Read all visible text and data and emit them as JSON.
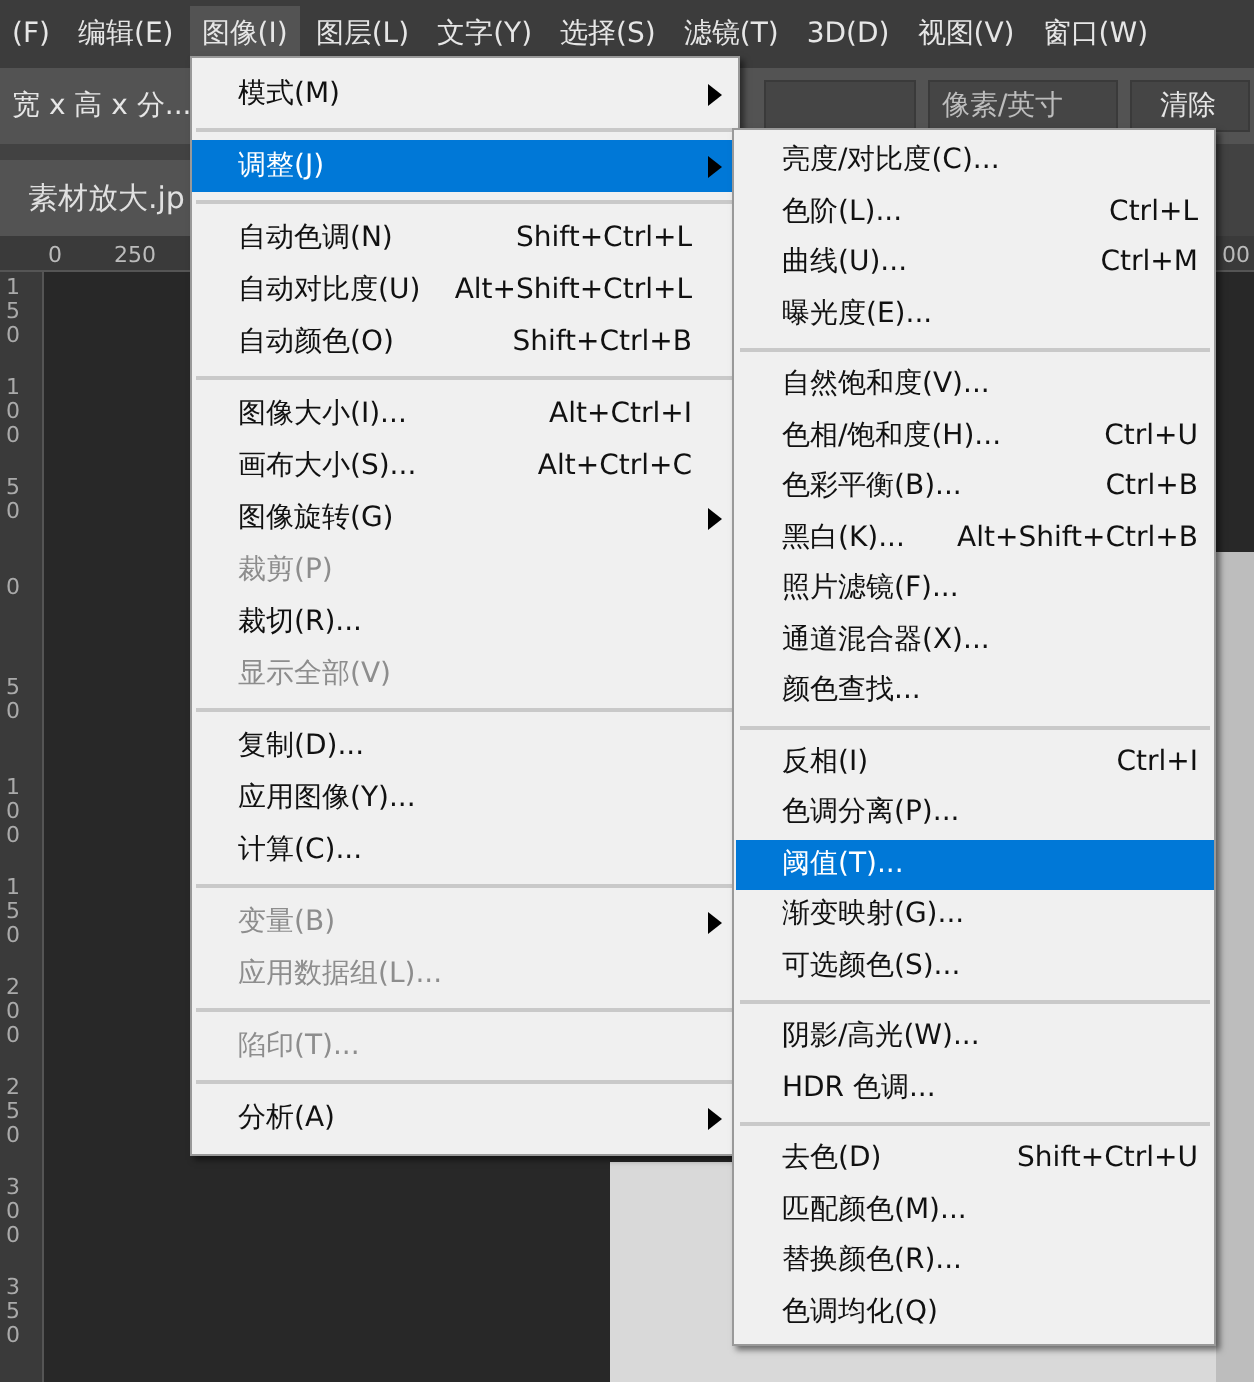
{
  "menubar": [
    {
      "label": "(F)",
      "selected": false
    },
    {
      "label": "编辑(E)",
      "selected": false
    },
    {
      "label": "图像(I)",
      "selected": true
    },
    {
      "label": "图层(L)",
      "selected": false
    },
    {
      "label": "文字(Y)",
      "selected": false
    },
    {
      "label": "选择(S)",
      "selected": false
    },
    {
      "label": "滤镜(T)",
      "selected": false
    },
    {
      "label": "3D(D)",
      "selected": false
    },
    {
      "label": "视图(V)",
      "selected": false
    },
    {
      "label": "窗口(W)",
      "selected": false
    }
  ],
  "options_bar": {
    "size_dropdown": "宽 x 高 x 分...",
    "unit_dropdown": "像素/英寸",
    "clear_button": "清除"
  },
  "document_tab": {
    "title": "素材放大.jp"
  },
  "horizontal_ruler": [
    "0",
    "250",
    "00"
  ],
  "vertical_ruler": [
    "150",
    "100",
    "50",
    "0",
    "50",
    "100",
    "150",
    "200",
    "250",
    "300",
    "350"
  ],
  "image_menu": [
    {
      "kind": "item",
      "label": "模式(M)",
      "submenu": true,
      "disabled": false,
      "selected": false
    },
    {
      "kind": "separator"
    },
    {
      "kind": "item",
      "label": "调整(J)",
      "submenu": true,
      "disabled": false,
      "selected": true
    },
    {
      "kind": "separator"
    },
    {
      "kind": "item",
      "label": "自动色调(N)",
      "shortcut": "Shift+Ctrl+L",
      "submenu": false,
      "disabled": false,
      "selected": false
    },
    {
      "kind": "item",
      "label": "自动对比度(U)",
      "shortcut": "Alt+Shift+Ctrl+L",
      "submenu": false,
      "disabled": false,
      "selected": false
    },
    {
      "kind": "item",
      "label": "自动颜色(O)",
      "shortcut": "Shift+Ctrl+B",
      "submenu": false,
      "disabled": false,
      "selected": false
    },
    {
      "kind": "separator"
    },
    {
      "kind": "item",
      "label": "图像大小(I)...",
      "shortcut": "Alt+Ctrl+I",
      "submenu": false,
      "disabled": false,
      "selected": false
    },
    {
      "kind": "item",
      "label": "画布大小(S)...",
      "shortcut": "Alt+Ctrl+C",
      "submenu": false,
      "disabled": false,
      "selected": false
    },
    {
      "kind": "item",
      "label": "图像旋转(G)",
      "submenu": true,
      "disabled": false,
      "selected": false
    },
    {
      "kind": "item",
      "label": "裁剪(P)",
      "submenu": false,
      "disabled": true,
      "selected": false
    },
    {
      "kind": "item",
      "label": "裁切(R)...",
      "submenu": false,
      "disabled": false,
      "selected": false
    },
    {
      "kind": "item",
      "label": "显示全部(V)",
      "submenu": false,
      "disabled": true,
      "selected": false
    },
    {
      "kind": "separator"
    },
    {
      "kind": "item",
      "label": "复制(D)...",
      "submenu": false,
      "disabled": false,
      "selected": false
    },
    {
      "kind": "item",
      "label": "应用图像(Y)...",
      "submenu": false,
      "disabled": false,
      "selected": false
    },
    {
      "kind": "item",
      "label": "计算(C)...",
      "submenu": false,
      "disabled": false,
      "selected": false
    },
    {
      "kind": "separator"
    },
    {
      "kind": "item",
      "label": "变量(B)",
      "submenu": true,
      "disabled": true,
      "selected": false
    },
    {
      "kind": "item",
      "label": "应用数据组(L)...",
      "submenu": false,
      "disabled": true,
      "selected": false
    },
    {
      "kind": "separator"
    },
    {
      "kind": "item",
      "label": "陷印(T)...",
      "submenu": false,
      "disabled": true,
      "selected": false
    },
    {
      "kind": "separator"
    },
    {
      "kind": "item",
      "label": "分析(A)",
      "submenu": true,
      "disabled": false,
      "selected": false
    }
  ],
  "adjust_submenu": [
    {
      "kind": "item",
      "label": "亮度/对比度(C)...",
      "selected": false
    },
    {
      "kind": "item",
      "label": "色阶(L)...",
      "shortcut": "Ctrl+L",
      "selected": false
    },
    {
      "kind": "item",
      "label": "曲线(U)...",
      "shortcut": "Ctrl+M",
      "selected": false
    },
    {
      "kind": "item",
      "label": "曝光度(E)...",
      "selected": false
    },
    {
      "kind": "separator"
    },
    {
      "kind": "item",
      "label": "自然饱和度(V)...",
      "selected": false
    },
    {
      "kind": "item",
      "label": "色相/饱和度(H)...",
      "shortcut": "Ctrl+U",
      "selected": false
    },
    {
      "kind": "item",
      "label": "色彩平衡(B)...",
      "shortcut": "Ctrl+B",
      "selected": false
    },
    {
      "kind": "item",
      "label": "黑白(K)...",
      "shortcut": "Alt+Shift+Ctrl+B",
      "selected": false
    },
    {
      "kind": "item",
      "label": "照片滤镜(F)...",
      "selected": false
    },
    {
      "kind": "item",
      "label": "通道混合器(X)...",
      "selected": false
    },
    {
      "kind": "item",
      "label": "颜色查找...",
      "selected": false
    },
    {
      "kind": "separator"
    },
    {
      "kind": "item",
      "label": "反相(I)",
      "shortcut": "Ctrl+I",
      "selected": false
    },
    {
      "kind": "item",
      "label": "色调分离(P)...",
      "selected": false
    },
    {
      "kind": "item",
      "label": "阈值(T)...",
      "selected": true
    },
    {
      "kind": "item",
      "label": "渐变映射(G)...",
      "selected": false
    },
    {
      "kind": "item",
      "label": "可选颜色(S)...",
      "selected": false
    },
    {
      "kind": "separator"
    },
    {
      "kind": "item",
      "label": "阴影/高光(W)...",
      "selected": false
    },
    {
      "kind": "item",
      "label": "HDR 色调...",
      "selected": false
    },
    {
      "kind": "separator"
    },
    {
      "kind": "item",
      "label": "去色(D)",
      "shortcut": "Shift+Ctrl+U",
      "selected": false
    },
    {
      "kind": "item",
      "label": "匹配颜色(M)...",
      "selected": false
    },
    {
      "kind": "item",
      "label": "替换颜色(R)...",
      "selected": false
    },
    {
      "kind": "item",
      "label": "色调均化(Q)",
      "selected": false
    }
  ]
}
